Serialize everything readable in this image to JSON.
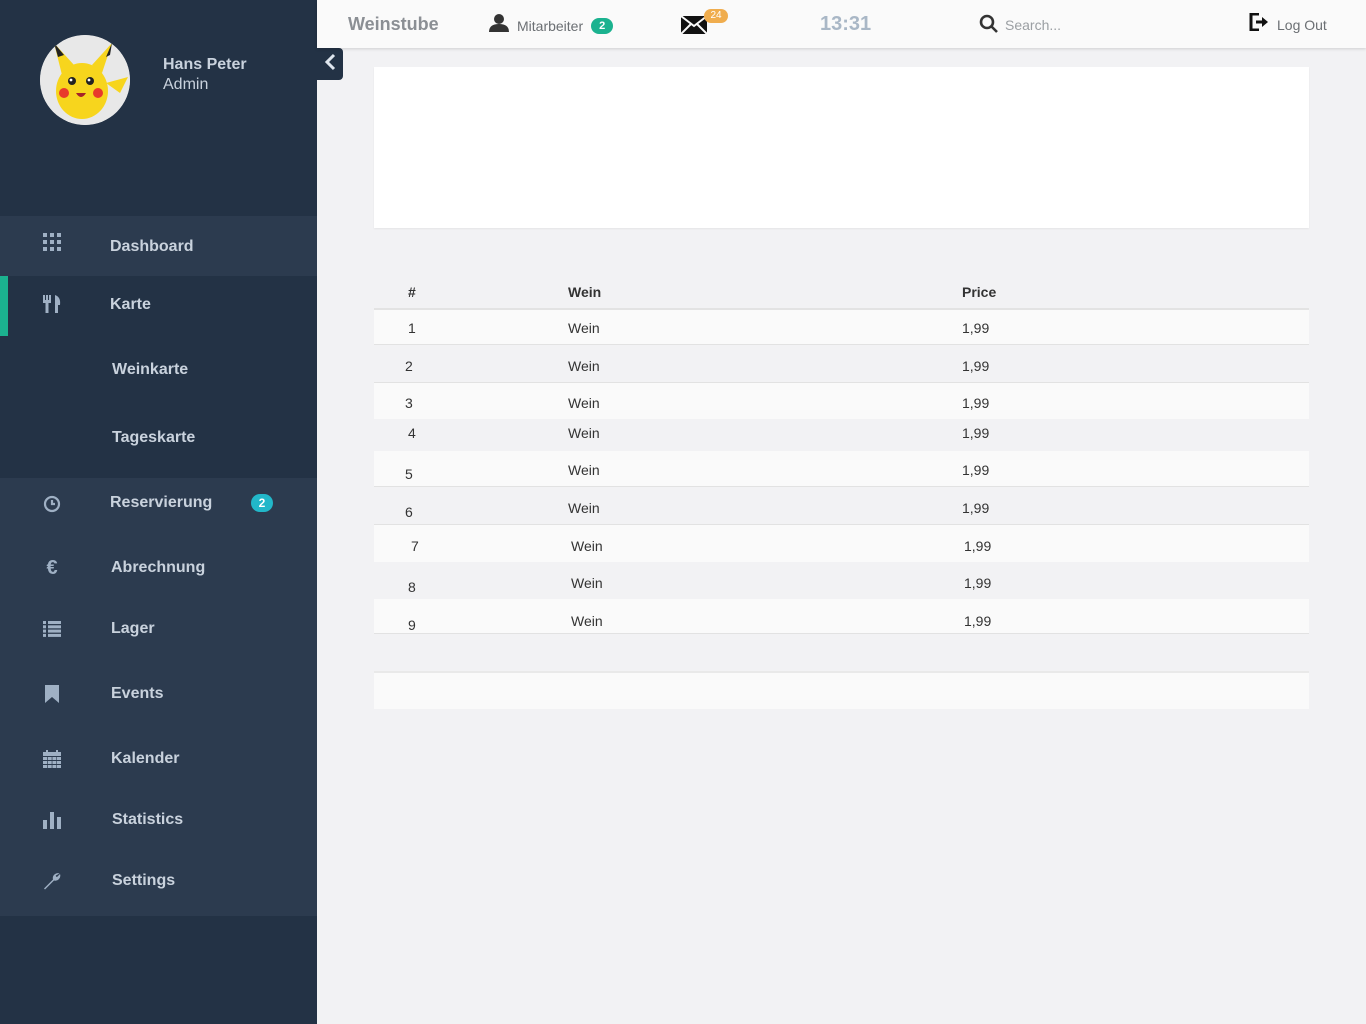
{
  "user": {
    "name": "Hans Peter",
    "role": "Admin"
  },
  "sidebar": {
    "items": [
      {
        "label": "Dashboard",
        "icon": "grid-icon"
      },
      {
        "label": "Karte",
        "icon": "cutlery-icon"
      },
      {
        "label": "Weinkarte"
      },
      {
        "label": "Tageskarte"
      },
      {
        "label": "Reservierung",
        "icon": "clock-icon",
        "badge": "2"
      },
      {
        "label": "Abrechnung",
        "icon": "euro-icon"
      },
      {
        "label": "Lager",
        "icon": "list-icon"
      },
      {
        "label": "Events",
        "icon": "bookmark-icon"
      },
      {
        "label": "Kalender",
        "icon": "calendar-icon"
      },
      {
        "label": "Statistics",
        "icon": "bar-chart-icon"
      },
      {
        "label": "Settings",
        "icon": "wrench-icon"
      }
    ]
  },
  "header": {
    "brand": "Weinstube",
    "staff_label": "Mitarbeiter",
    "staff_badge": "2",
    "mail_badge": "24",
    "time": "13:31",
    "search_placeholder": "Search...",
    "logout_label": "Log Out"
  },
  "table": {
    "columns": [
      "#",
      "Wein",
      "Price"
    ],
    "rows": [
      [
        "1",
        "Wein",
        "1,99"
      ],
      [
        "2",
        "Wein",
        "1,99"
      ],
      [
        "3",
        "Wein",
        "1,99"
      ],
      [
        "4",
        "Wein",
        "1,99"
      ],
      [
        "5",
        "Wein",
        "1,99"
      ],
      [
        "6",
        "Wein",
        "1,99"
      ],
      [
        "7",
        "Wein",
        "1,99"
      ],
      [
        "8",
        "Wein",
        "1,99"
      ],
      [
        "9",
        "Wein",
        "1,99"
      ]
    ]
  },
  "colors": {
    "accent": "#1bb28f",
    "sidebar": "#233245",
    "badge_info": "#22b7c9",
    "badge_warning": "#f0ad4e"
  }
}
